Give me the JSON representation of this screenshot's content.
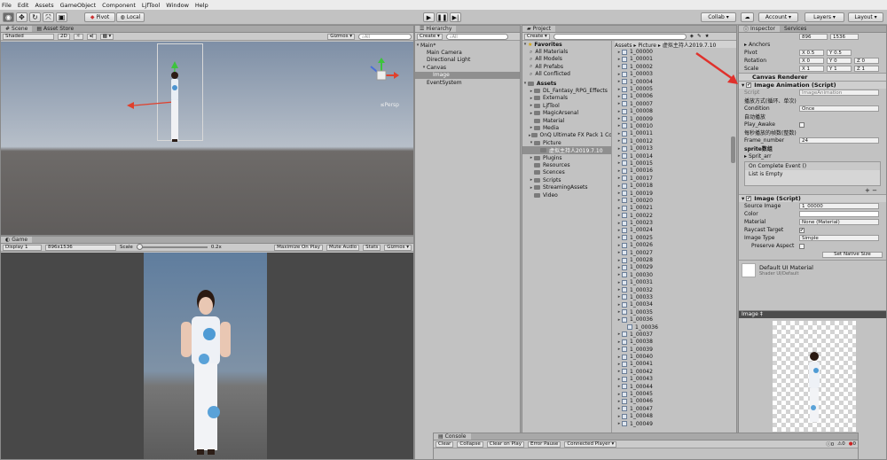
{
  "menu": [
    "File",
    "Edit",
    "Assets",
    "GameObject",
    "Component",
    "LjfTool",
    "Window",
    "Help"
  ],
  "toolbar": {
    "pivot": "Pivot",
    "local": "Local",
    "collab": "Collab ▾",
    "account": "Account ▾",
    "layers": "Layers ▾",
    "layout": "Layout ▾"
  },
  "scene": {
    "tab_scene": "Scene",
    "tab_asset_store": "Asset Store",
    "shading": "Shaded",
    "mode_2d": "2D",
    "gizmos": "Gizmos ▾",
    "search": "All",
    "persp": "≤Persp"
  },
  "game": {
    "tab": "Game",
    "display": "Display 1",
    "resolution": "896x1536",
    "scale_label": "Scale",
    "scale_value": "0.2x",
    "maximize": "Maximize On Play",
    "mute": "Mute Audio",
    "stats": "Stats",
    "gizmos": "Gizmos ▾"
  },
  "hierarchy": {
    "tab": "Hierarchy",
    "create": "Create ▾",
    "search": "All",
    "items": [
      {
        "label": "Main*",
        "depth": 0,
        "fold": "▾",
        "state": ""
      },
      {
        "label": "Main Camera",
        "depth": 1,
        "fold": "",
        "state": ""
      },
      {
        "label": "Directional Light",
        "depth": 1,
        "fold": "",
        "state": ""
      },
      {
        "label": "Canvas",
        "depth": 1,
        "fold": "▾",
        "state": ""
      },
      {
        "label": "Image",
        "depth": 2,
        "fold": "",
        "state": "selgray"
      },
      {
        "label": "EventSystem",
        "depth": 1,
        "fold": "",
        "state": ""
      }
    ]
  },
  "project": {
    "tab": "Project",
    "create": "Create ▾",
    "favorites_label": "Favorites",
    "favorites": [
      "All Materials",
      "All Models",
      "All Prefabs",
      "All Conflicted"
    ],
    "assets_label": "Assets",
    "assets": [
      {
        "label": "DL_Fantasy_RPG_Effects",
        "depth": 1,
        "fold": "▸",
        "state": ""
      },
      {
        "label": "Externals",
        "depth": 1,
        "fold": "▸",
        "state": ""
      },
      {
        "label": "LjfTool",
        "depth": 1,
        "fold": "▸",
        "state": ""
      },
      {
        "label": "MagicArsenal",
        "depth": 1,
        "fold": "▸",
        "state": ""
      },
      {
        "label": "Material",
        "depth": 1,
        "fold": "",
        "state": ""
      },
      {
        "label": "Media",
        "depth": 1,
        "fold": "▸",
        "state": ""
      },
      {
        "label": "OnQ Ultimate FX Pack 1 Co",
        "depth": 1,
        "fold": "▸",
        "state": ""
      },
      {
        "label": "Picture",
        "depth": 1,
        "fold": "▾",
        "state": ""
      },
      {
        "label": "虚拟主持人2019.7.10",
        "depth": 2,
        "fold": "",
        "state": "selgray"
      },
      {
        "label": "Plugins",
        "depth": 1,
        "fold": "▸",
        "state": ""
      },
      {
        "label": "Resources",
        "depth": 1,
        "fold": "",
        "state": ""
      },
      {
        "label": "Scences",
        "depth": 1,
        "fold": "",
        "state": ""
      },
      {
        "label": "Scripts",
        "depth": 1,
        "fold": "▸",
        "state": ""
      },
      {
        "label": "StreamingAssets",
        "depth": 1,
        "fold": "▸",
        "state": ""
      },
      {
        "label": "Video",
        "depth": 1,
        "fold": "",
        "state": ""
      }
    ],
    "breadcrumb": "Assets ▸ Picture ▸ 虚拟主持人2019.7.10",
    "files": [
      "1_00000",
      "1_00001",
      "1_00002",
      "1_00003",
      "1_00004",
      "1_00005",
      "1_00006",
      "1_00007",
      "1_00008",
      "1_00009",
      "1_00010",
      "1_00011",
      "1_00012",
      "1_00013",
      "1_00014",
      "1_00015",
      "1_00016",
      "1_00017",
      "1_00018",
      "1_00019",
      "1_00020",
      "1_00021",
      "1_00022",
      "1_00023",
      "1_00024",
      "1_00025",
      "1_00026",
      "1_00027",
      "1_00028",
      "1_00029",
      "1_00030",
      "1_00031",
      "1_00032",
      "1_00033",
      "1_00034",
      "1_00035",
      "1_00036",
      "1_00036",
      "1_00037",
      "1_00038",
      "1_00039",
      "1_00040",
      "1_00041",
      "1_00042",
      "1_00043",
      "1_00044",
      "1_00045",
      "1_00046",
      "1_00047",
      "1_00048",
      "1_00049"
    ]
  },
  "inspector": {
    "tab_inspector": "Inspector",
    "tab_services": "Services",
    "size_w": "896",
    "size_h": "1536",
    "anchors": "Anchors",
    "pivot_label": "Pivot",
    "pivot_x": "X 0.5",
    "pivot_y": "Y 0.5",
    "rotation_label": "Rotation",
    "rot_x": "X 0",
    "rot_y": "Y 0",
    "rot_z": "Z 0",
    "scale_label": "Scale",
    "scale_x": "X 1",
    "scale_y": "Y 1",
    "scale_z": "Z 1",
    "canvas_renderer": "Canvas Renderer",
    "image_anim": "Image Animation (Script)",
    "script_label": "Script",
    "script_value": "ImageAnimation",
    "play_mode_cn": "播放方式(循环、单次)",
    "condition_label": "Condition",
    "condition_value": "Once",
    "autoplay_cn": "自动播放",
    "play_awake": "Play_Awake",
    "frame_cn": "每秒播放的帧数(整数)",
    "frame_label": "Frame_number",
    "frame_value": "24",
    "sprite_cn": "sprite数组",
    "sprit_arr": "Sprit_arr",
    "on_complete": "On Complete Event ()",
    "list_empty": "List is Empty",
    "image_script": "Image (Script)",
    "source_image_label": "Source Image",
    "source_image_value": "1_00000",
    "color_label": "Color",
    "material_label": "Material",
    "material_value": "None (Material)",
    "raycast_label": "Raycast Target",
    "image_type_label": "Image Type",
    "image_type_value": "Simple",
    "preserve_label": "Preserve Aspect",
    "set_native": "Set Native Size",
    "default_mat": "Default UI Material",
    "shader_label": "Shader",
    "shader_value": "UI/Default",
    "preview_label": "Image ‡"
  },
  "console": {
    "tab": "Console",
    "clear": "Clear",
    "collapse": "Collapse",
    "clear_on_play": "Clear on Play",
    "error_pause": "Error Pause",
    "connected": "Connected Player ▾",
    "count_info": "0",
    "count_warn": "0",
    "count_err": "0"
  },
  "colors": {
    "selection": "#3e7ce0",
    "panel": "#c2c2c2",
    "arrow": "#e0312c"
  }
}
